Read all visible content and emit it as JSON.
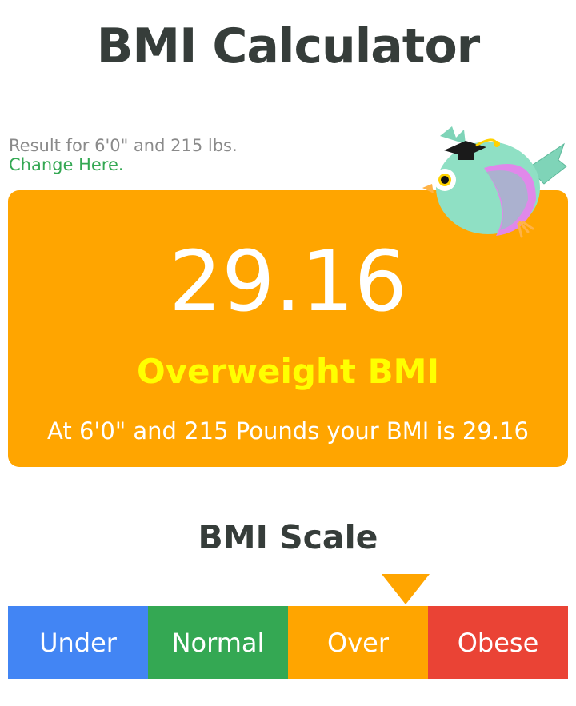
{
  "header": {
    "title": "BMI Calculator"
  },
  "result": {
    "prefix": "Result for 6'0\" and 215 lbs.",
    "change_link": "Change Here",
    "change_suffix": "."
  },
  "card": {
    "bmi_value": "29.16",
    "category": "Overweight BMI",
    "summary": "At 6'0\" and 215 Pounds your BMI is 29.16",
    "color": "#ffa500"
  },
  "scale": {
    "title": "BMI Scale",
    "segments": [
      {
        "label": "Under",
        "color": "#4285f4"
      },
      {
        "label": "Normal",
        "color": "#34a853"
      },
      {
        "label": "Over",
        "color": "#ffa500"
      },
      {
        "label": "Obese",
        "color": "#ea4335"
      }
    ],
    "active_segment": "Over"
  },
  "icons": {
    "mascot": "owl-graduate-icon",
    "pointer": "triangle-down-icon"
  }
}
